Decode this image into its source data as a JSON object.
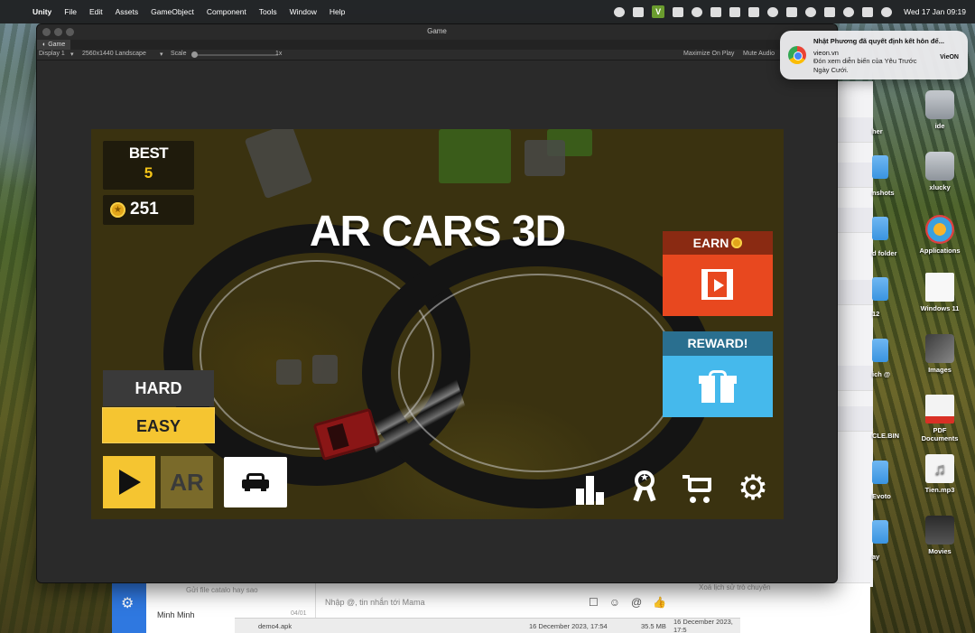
{
  "menubar": {
    "app_name": "Unity",
    "menus": [
      "File",
      "Edit",
      "Assets",
      "GameObject",
      "Component",
      "Tools",
      "Window",
      "Help"
    ],
    "clock": "Wed 17 Jan  09:19"
  },
  "notification": {
    "title": "Nhật Phương đã quyết định kết hôn để...",
    "site": "vieon.vn",
    "body": "Đón xem diễn biến của Yêu Trước Ngày Cưới.",
    "logo": "VieON"
  },
  "unity_window": {
    "title": "Game",
    "tab": "Game",
    "display": "Display 1",
    "resolution": "2560x1440 Landscape",
    "scale_label": "Scale",
    "scale_value": "1x",
    "maximize_on_play": "Maximize On Play",
    "mute_audio": "Mute Audio"
  },
  "game": {
    "title": "AR CARS 3D",
    "best_label": "BEST",
    "best_value": "5",
    "coins": "251",
    "earn_label": "EARN",
    "reward_label": "REWARD!",
    "mode_hard": "HARD",
    "mode_easy": "EASY",
    "ar_label": "AR",
    "accent_yellow": "#f5c531",
    "earn_color": "#e8481f",
    "reward_color": "#45b9ec"
  },
  "desktop_icons": [
    {
      "label": "ide"
    },
    {
      "label": "xlucky"
    },
    {
      "label": "Applications"
    },
    {
      "label": "Windows 11"
    },
    {
      "label": "Images"
    },
    {
      "label": "PDF Documents"
    },
    {
      "label": "Tien.mp3"
    },
    {
      "label": "Movies"
    }
  ],
  "desktop_edge_labels": [
    "her",
    "nshots",
    "d folder",
    "12",
    "ich @",
    "CLE.BIN",
    "Evoto",
    "ay"
  ],
  "chat": {
    "preview": "Gửi file catalo hay sao",
    "contact": "Minh Minh",
    "date": "04/01",
    "message_placeholder": "Nhập @, tin nhắn tới Mama",
    "history": "Xoá lịch sử trò chuyện"
  },
  "finder": {
    "file": "demo4.apk",
    "date1": "16 December 2023, 17:54",
    "size": "35.5 MB",
    "date2": "16 December 2023, 17:5"
  }
}
